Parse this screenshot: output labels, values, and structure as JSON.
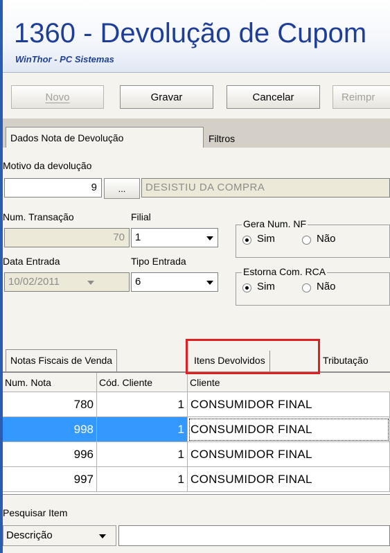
{
  "window": {
    "title": "1360 - Devolução de Cupom",
    "subtitle": "WinThor - PC Sistemas"
  },
  "toolbar": {
    "novo": "Novo",
    "gravar": "Gravar",
    "cancelar": "Cancelar",
    "reimprimir": "Reimpr"
  },
  "tabs_top": [
    {
      "label": "Dados Nota de Devolução"
    },
    {
      "label": "Filtros"
    }
  ],
  "form": {
    "motivo_label": "Motivo da devolução",
    "motivo_code": "9",
    "motivo_button": "...",
    "motivo_desc": "DESISTIU DA COMPRA",
    "num_transacao_label": "Num. Transação",
    "num_transacao": "70",
    "filial_label": "Filial",
    "filial": "1",
    "data_entrada_label": "Data Entrada",
    "data_entrada": "10/02/2011",
    "tipo_entrada_label": "Tipo Entrada",
    "tipo_entrada": "6",
    "gera_num_nf": {
      "label": "Gera Num. NF",
      "sim": "Sim",
      "nao": "Não",
      "selected": "Sim"
    },
    "estorna_com_rca": {
      "label": "Estorna Com. RCA",
      "sim": "Sim",
      "nao": "Não",
      "selected": "Sim"
    }
  },
  "tabs_bottom": [
    {
      "label": "Notas Fiscais de Venda"
    },
    {
      "label": "Itens Devolvidos"
    },
    {
      "label": "Tributação"
    }
  ],
  "grid": {
    "headers": [
      "Num. Nota",
      "Cód. Cliente",
      "Cliente"
    ],
    "rows": [
      {
        "num_nota": "780",
        "cod_cliente": "1",
        "cliente": "CONSUMIDOR FINAL"
      },
      {
        "num_nota": "998",
        "cod_cliente": "1",
        "cliente": "CONSUMIDOR FINAL"
      },
      {
        "num_nota": "996",
        "cod_cliente": "1",
        "cliente": "CONSUMIDOR FINAL"
      },
      {
        "num_nota": "997",
        "cod_cliente": "1",
        "cliente": "CONSUMIDOR FINAL"
      }
    ]
  },
  "search": {
    "label": "Pesquisar Item",
    "field_type": "Descrição",
    "value": ""
  },
  "colors": {
    "title": "#1f3f96",
    "selection": "#3399ff",
    "highlight_box": "#e02020"
  }
}
